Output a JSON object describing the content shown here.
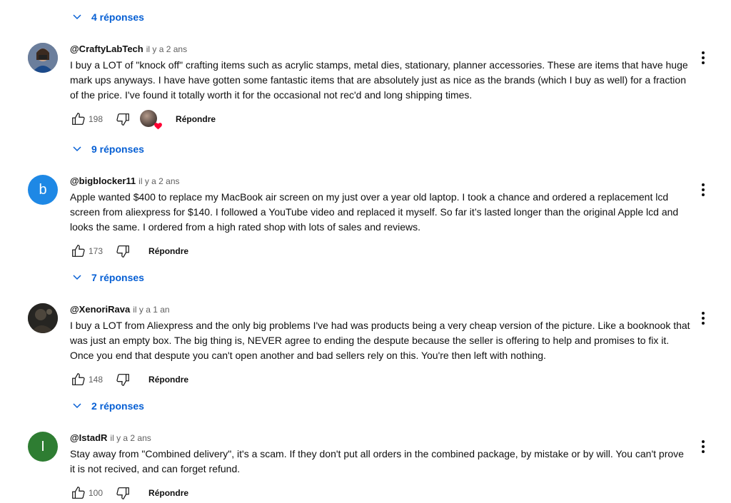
{
  "threads": [
    {
      "replies_label": "4 réponses"
    },
    {
      "author": "@CraftyLabTech",
      "time": "il y a 2 ans",
      "text": "I buy a LOT of \"knock off\" crafting items such as acrylic stamps, metal dies, stationary, planner accessories.  These are items that have huge mark ups anyways.  I have have gotten some fantastic items that are absolutely just as nice as the brands (which I buy as well) for a fraction of the price.  I've found it totally worth it for the occasional not rec'd and long shipping times.",
      "likes": "198",
      "reply_label": "Répondre",
      "replies_label": "9 réponses",
      "avatar_color": "#4a5a78"
    },
    {
      "author": "@bigblocker11",
      "time": "il y a 2 ans",
      "text": "Apple wanted $400 to replace my MacBook air screen on my just over a year old laptop. I took a chance and ordered a replacement lcd screen from aliexpress for $140. I followed a YouTube video and replaced it myself. So far it’s lasted longer than the original Apple lcd and looks the same. I ordered from a high rated shop with lots of sales and reviews.",
      "likes": "173",
      "reply_label": "Répondre",
      "replies_label": "7 réponses",
      "avatar_letter": "b",
      "avatar_color": "#1e88e5"
    },
    {
      "author": "@XenoriRava",
      "time": "il y a 1 an",
      "text": "I buy a LOT from Aliexpress and the only big problems I've had was products being a very cheap version of the picture. Like a booknook that was just an empty box. The big thing is, NEVER agree to ending the despute because the seller is offering to help and promises to fix it. Once you end that despute you can't open another and bad sellers rely on this. You're then left with nothing.",
      "likes": "148",
      "reply_label": "Répondre",
      "replies_label": "2 réponses",
      "avatar_color": "#2b2a28"
    },
    {
      "author": "@IstadR",
      "time": "il y a 2 ans",
      "text": "Stay away from \"Combined delivery\", it's a scam. If they don't put all orders in the combined package, by mistake or by will. You can't prove it is not recived, and can forget refund.",
      "likes": "100",
      "reply_label": "Répondre",
      "avatar_letter": "I",
      "avatar_color": "#2e7d32"
    }
  ],
  "colors": {
    "link": "#065fd4",
    "secondary_text": "#606060",
    "heart": "#ff0033"
  }
}
